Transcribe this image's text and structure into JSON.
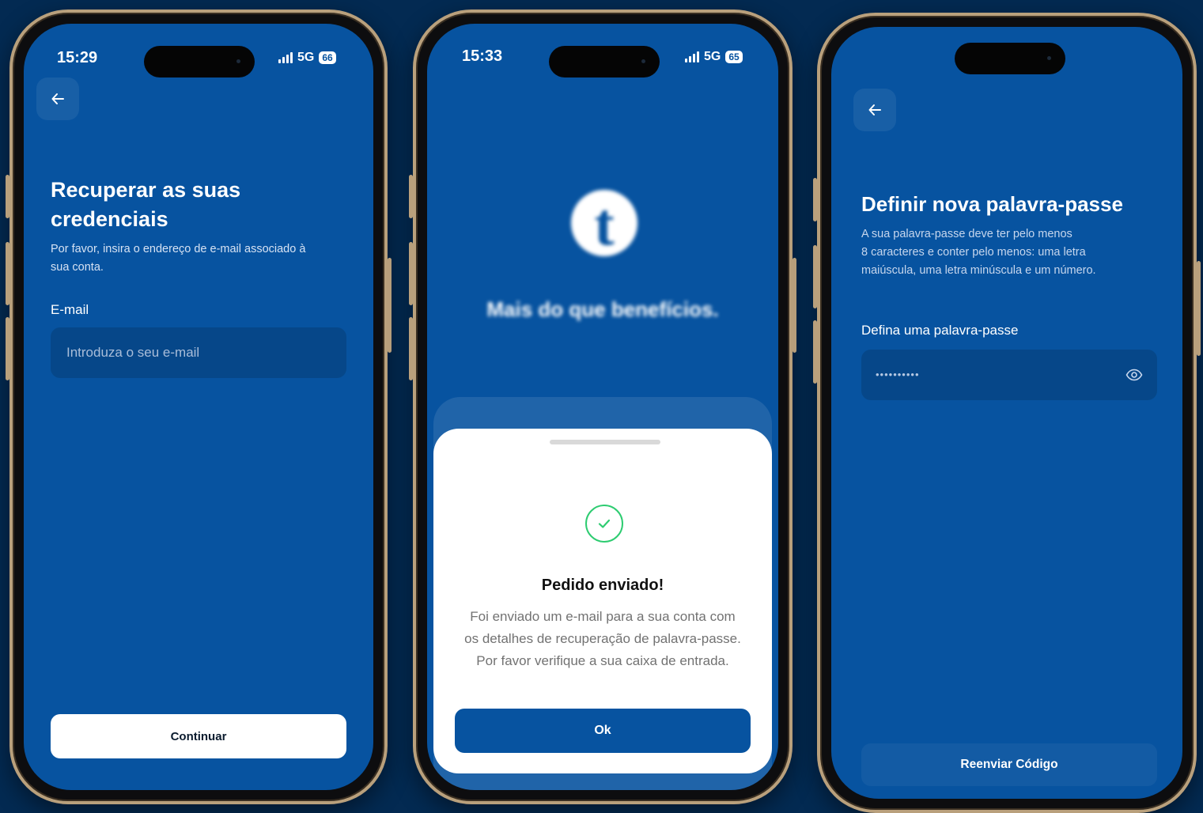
{
  "colors": {
    "background": "#032a52",
    "screen_blue": "#0753a0",
    "success_green": "#2ecc71"
  },
  "screen1": {
    "status": {
      "time": "15:29",
      "network": "5G",
      "battery": "66"
    },
    "title_line1": "Recuperar as suas",
    "title_line2": "credenciais",
    "subtitle_line1": "Por favor, insira o endereço de e-mail associado à",
    "subtitle_line2": "sua conta.",
    "email_label": "E-mail",
    "email_placeholder": "Introduza o seu e-mail",
    "email_value": "",
    "continue_label": "Continuar",
    "back_icon": "arrow-left-icon"
  },
  "screen2": {
    "status": {
      "time": "15:33",
      "network": "5G",
      "battery": "65"
    },
    "logo_letter": "t",
    "tagline": "Mais do que benefícios.",
    "sheet": {
      "title": "Pedido enviado!",
      "body_line1": "Foi enviado um e-mail para a sua conta com",
      "body_line2": "os detalhes de recuperação de palavra-passe.",
      "body_line3": "Por favor verifique a sua caixa de entrada.",
      "ok_label": "Ok",
      "icon": "check-circle-icon"
    }
  },
  "screen3": {
    "title": "Definir nova palavra-passe",
    "subtitle_line1": "A sua palavra-passe deve ter pelo menos",
    "subtitle_line2": "8 caracteres e conter pelo menos: uma letra",
    "subtitle_line3": "maiúscula, uma letra minúscula e um número.",
    "password_label": "Defina uma palavra-passe",
    "password_masked": "••••••••••",
    "resend_label": "Reenviar Código",
    "back_icon": "arrow-left-icon",
    "eye_icon": "eye-icon"
  }
}
